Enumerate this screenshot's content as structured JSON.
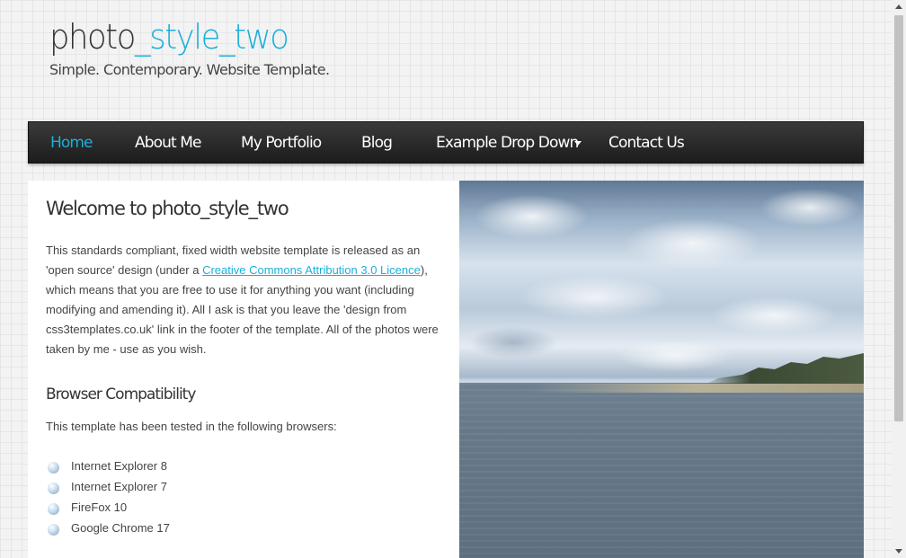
{
  "header": {
    "logo_part1": "photo",
    "logo_part2": "_style_two",
    "slogan": "Simple. Contemporary. Website Template."
  },
  "menu": {
    "items": [
      {
        "label": "Home",
        "active": true
      },
      {
        "label": "About Me"
      },
      {
        "label": "My Portfolio"
      },
      {
        "label": "Blog"
      },
      {
        "label": "Example Drop Down",
        "has_dropdown": true
      },
      {
        "label": "Contact Us"
      }
    ]
  },
  "content": {
    "heading": "Welcome to photo_style_two",
    "intro_before_link": "This standards compliant, fixed width website template is released as an 'open source' design (under a ",
    "intro_link": "Creative Commons Attribution 3.0 Licence",
    "intro_after_link": "), which means that you are free to use it for anything you want (including modifying and amending it). All I ask is that you leave the 'design from css3templates.co.uk' link in the footer of the template. All of the photos were taken by me - use as you wish.",
    "subheading": "Browser Compatibility",
    "browsers_intro": "This template has been tested in the following browsers:",
    "browsers": [
      "Internet Explorer 8",
      "Internet Explorer 7",
      "FireFox 10",
      "Google Chrome 17"
    ]
  },
  "colors": {
    "accent": "#1ab0dc",
    "menubar": "#2a2a2a",
    "text": "#444444"
  }
}
